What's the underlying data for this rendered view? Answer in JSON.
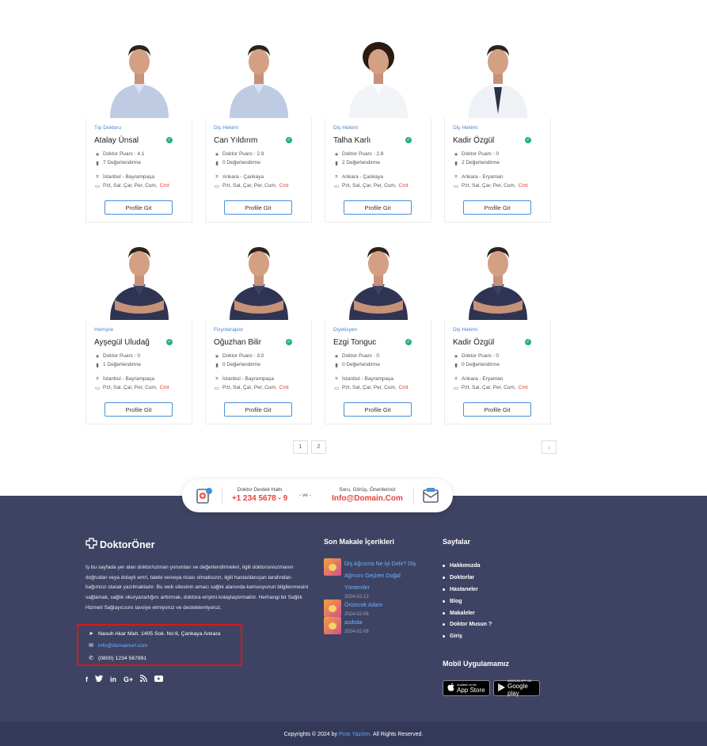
{
  "doctors": [
    {
      "specialty": "Tıp Doktoru",
      "name": "Atalay Ünsal",
      "rating": "Doktor Puanı : 4.1",
      "reviews": "7 Değerlendirme",
      "location": "İstanbul - Bayrampaşa",
      "days": "Pzt, Sal, Çar, Per, Cum,",
      "days_extra": "Cmt",
      "button": "Profile Git",
      "photo": "shirt"
    },
    {
      "specialty": "Diş Hekimi",
      "name": "Can Yıldırım",
      "rating": "Doktor Puanı : 2.9",
      "reviews": "0 Değerlendirme",
      "location": "Ankara - Çankaya",
      "days": "Pzt, Sal, Çar, Per, Cum,",
      "days_extra": "Cmt",
      "button": "Profile Git",
      "photo": "shirt"
    },
    {
      "specialty": "Diş Hekimi",
      "name": "Talha Karlı",
      "rating": "Doktor Puanı : 2.8",
      "reviews": "2 Değerlendirme",
      "location": "Ankara - Çankaya",
      "days": "Pzt, Sal, Çar, Per, Cum,",
      "days_extra": "Cmt",
      "button": "Profile Git",
      "photo": "white"
    },
    {
      "specialty": "Diş Hekimi",
      "name": "Kadir Özgül",
      "rating": "Doktor Puanı : 0",
      "reviews": "2 Değerlendirme",
      "location": "Ankara - Eryaman",
      "days": "Pzt, Sal, Çar, Per, Cum,",
      "days_extra": "Cmt",
      "button": "Profile Git",
      "photo": "coat"
    },
    {
      "specialty": "Hemşire",
      "name": "Ayşegül Uludağ",
      "rating": "Doktor Puanı : 0",
      "reviews": "1 Değerlendirme",
      "location": "İstanbul - Bayrampaşa",
      "days": "Pzt, Sal, Çar, Per, Cum,",
      "days_extra": "Cmt",
      "button": "Profile Git",
      "photo": "navy"
    },
    {
      "specialty": "Fizyoterapist",
      "name": "Oğuzhan Bilir",
      "rating": "Doktor Puanı : 3.0",
      "reviews": "0 Değerlendirme",
      "location": "İstanbul - Bayrampaşa",
      "days": "Pzt, Sal, Çar, Per, Cum,",
      "days_extra": "Cmt",
      "button": "Profile Git",
      "photo": "navy"
    },
    {
      "specialty": "Diyetisyen",
      "name": "Ezgi Tonguc",
      "rating": "Doktor Puanı : 0",
      "reviews": "0 Değerlendirme",
      "location": "İstanbul - Bayrampaşa",
      "days": "Pzt, Sal, Çar, Per, Cum,",
      "days_extra": "Cmt",
      "button": "Profile Git",
      "photo": "navy"
    },
    {
      "specialty": "Diş Hekimi",
      "name": "Kadir Özgül",
      "rating": "Doktor Puanı : 0",
      "reviews": "0 Değerlendirme",
      "location": "Ankara - Eryaman",
      "days": "Pzt, Sal, Çar, Per, Cum,",
      "days_extra": "Cmt",
      "button": "Profile Git",
      "photo": "navy"
    }
  ],
  "pagination": {
    "pages": [
      "1",
      "2"
    ],
    "next_icon": "chevron-right-icon"
  },
  "support": {
    "phone_label": "Doktor Destek Hattı",
    "phone": "+1 234 5678 - 9",
    "and": "- ve -",
    "email_label": "Soru, Görüş, Önerileriniz",
    "email": "Info@Domain.Com"
  },
  "footer": {
    "logo_text": "DoktorÖner",
    "about": "İş bu sayfada yer alan doktor/uzman yorumları ve değerlendirmeleri, ilgili doktorun/uzmanın doğrudan veya dolaylı emri, talebi ve/veya ricası olmaksızın, ilgili hasta/danışan tarafından bağımsız olarak yazılmaktadır. Bu web sitesinin amacı sağlık alanında kamuoyunun bilgilenmesini sağlamak, sağlık okuryazarlığını arttırmak, doktora erişimi kolaylaştırmaktır. Herhangi bir Sağlık Hizmeti Sağlayıcısını tavsiye etmiyoruz ve desteklemiyoruz.",
    "address": "Nasuh Akar Mah. 1405 Sok. No:6, Çankaya Ankara",
    "email": "info@domainurl.com",
    "phone": "(0800) 1234 567891",
    "social": [
      "f",
      "🐦",
      "in",
      "G+",
      "rss",
      "▶"
    ],
    "articles_title": "Son Makale İçerikleri",
    "articles": [
      {
        "title": "Diş Ağrısına Ne İyi Gelir? Diş Ağrısını Geçiren Doğal Yöntemler",
        "date": "2024-02-12"
      },
      {
        "title": "Örümcek Adam",
        "date": "2024-02-08"
      },
      {
        "title": "asdsda",
        "date": "2024-02-08"
      }
    ],
    "pages_title": "Sayfalar",
    "pages": [
      "Hakkımızda",
      "Doktorlar",
      "Hastaneler",
      "Blog",
      "Makaleler",
      "Doktor Musun ?",
      "Giriş"
    ],
    "mobile_title": "Mobil Uygulamamız",
    "appstore_small": "Available on the",
    "appstore": "App Store",
    "googleplay_small": "ANDROID APP ON",
    "googleplay": "Google play",
    "copyright_pre": "Copyrights © 2024 by",
    "copyright_brand": "Pros Yazılım.",
    "copyright_post": "All Rights Reserved."
  }
}
